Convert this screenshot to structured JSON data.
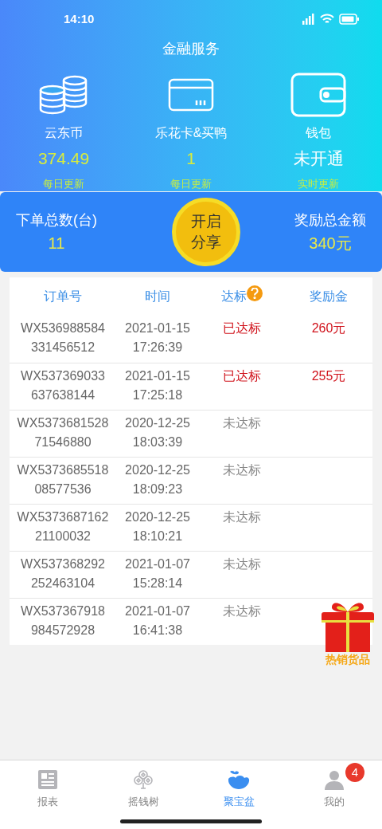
{
  "status_bar": {
    "time": "14:10"
  },
  "header": {
    "title": "金融服务"
  },
  "services": [
    {
      "kind": "coins",
      "label": "云东币",
      "value": "374.49",
      "value_highlight": true,
      "note": "每日更新"
    },
    {
      "kind": "card",
      "label": "乐花卡&买鸭",
      "value": "1",
      "value_highlight": true,
      "note": "每日更新"
    },
    {
      "kind": "wallet",
      "label": "钱包",
      "value": "未开通",
      "value_highlight": false,
      "note": "实时更新"
    }
  ],
  "summary": {
    "orders_label": "下单总数(台)",
    "orders_value": "11",
    "share_button": [
      "开启",
      "分享"
    ],
    "reward_label": "奖励总金额",
    "reward_value": "340元"
  },
  "table": {
    "columns": [
      "订单号",
      "时间",
      "达标",
      "奖励金"
    ],
    "rows": [
      {
        "order": [
          "WX536988584",
          "331456512"
        ],
        "time": [
          "2021-01-15",
          "17:26:39"
        ],
        "status": "已达标",
        "reached": true,
        "reward": "260元"
      },
      {
        "order": [
          "WX537369033",
          "637638144"
        ],
        "time": [
          "2021-01-15",
          "17:25:18"
        ],
        "status": "已达标",
        "reached": true,
        "reward": "255元"
      },
      {
        "order": [
          "WX5373681528",
          "71546880"
        ],
        "time": [
          "2020-12-25",
          "18:03:39"
        ],
        "status": "未达标",
        "reached": false
      },
      {
        "order": [
          "WX5373685518",
          "08577536"
        ],
        "time": [
          "2020-12-25",
          "18:09:23"
        ],
        "status": "未达标",
        "reached": false
      },
      {
        "order": [
          "WX5373687162",
          "21100032"
        ],
        "time": [
          "2020-12-25",
          "18:10:21"
        ],
        "status": "未达标",
        "reached": false
      },
      {
        "order": [
          "WX537368292",
          "252463104"
        ],
        "time": [
          "2021-01-07",
          "15:28:14"
        ],
        "status": "未达标",
        "reached": false
      },
      {
        "order": [
          "WX537367918",
          "984572928"
        ],
        "time": [
          "2021-01-07",
          "16:41:38"
        ],
        "status": "未达标",
        "reached": false
      }
    ]
  },
  "gift": {
    "label": "热销货品"
  },
  "tabs": [
    {
      "kind": "report",
      "label": "报表",
      "selected": false
    },
    {
      "kind": "tree",
      "label": "摇钱树",
      "selected": false
    },
    {
      "kind": "bowl",
      "label": "聚宝盆",
      "selected": true
    },
    {
      "kind": "user",
      "label": "我的",
      "selected": false,
      "badge": "4"
    }
  ]
}
